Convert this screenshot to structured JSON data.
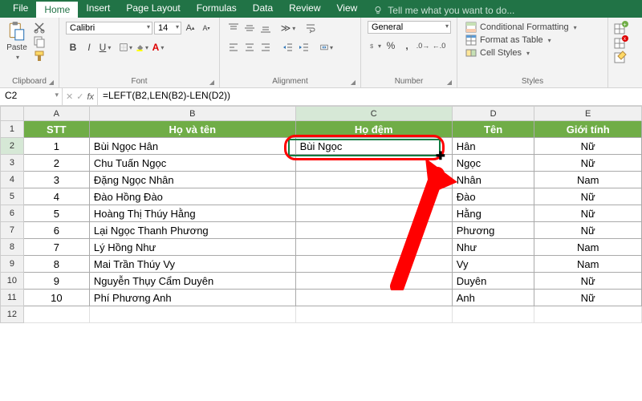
{
  "tabs": [
    "File",
    "Home",
    "Insert",
    "Page Layout",
    "Formulas",
    "Data",
    "Review",
    "View"
  ],
  "tellme": "Tell me what you want to do...",
  "clipboard": {
    "paste": "Paste",
    "label": "Clipboard"
  },
  "font": {
    "name": "Calibri",
    "size": "14",
    "label": "Font"
  },
  "alignment": {
    "label": "Alignment"
  },
  "number": {
    "format": "General",
    "label": "Number"
  },
  "styles": {
    "cf": "Conditional Formatting",
    "ft": "Format as Table",
    "cs": "Cell Styles",
    "label": "Styles"
  },
  "namebox": "C2",
  "formula": "=LEFT(B2,LEN(B2)-LEN(D2))",
  "cols": [
    "A",
    "B",
    "C",
    "D",
    "E"
  ],
  "headers": {
    "stt": "STT",
    "name": "Họ và tên",
    "mid": "Họ đệm",
    "last": "Tên",
    "sex": "Giới tính"
  },
  "chart_data": {
    "type": "table",
    "columns": [
      "STT",
      "Họ và tên",
      "Họ đệm",
      "Tên",
      "Giới tính"
    ],
    "rows": [
      {
        "stt": "1",
        "name": "Bùi Ngọc Hân",
        "mid": "Bùi Ngọc",
        "last": "Hân",
        "sex": "Nữ"
      },
      {
        "stt": "2",
        "name": "Chu Tuấn Ngọc",
        "mid": "",
        "last": "Ngọc",
        "sex": "Nữ"
      },
      {
        "stt": "3",
        "name": "Đặng Ngọc Nhân",
        "mid": "",
        "last": "Nhân",
        "sex": "Nam"
      },
      {
        "stt": "4",
        "name": "Đào Hồng Đào",
        "mid": "",
        "last": "Đào",
        "sex": "Nữ"
      },
      {
        "stt": "5",
        "name": "Hoàng Thị Thúy Hằng",
        "mid": "",
        "last": "Hằng",
        "sex": "Nữ"
      },
      {
        "stt": "6",
        "name": "Lại Ngọc Thanh Phương",
        "mid": "",
        "last": "Phương",
        "sex": "Nữ"
      },
      {
        "stt": "7",
        "name": "Lý Hồng Như",
        "mid": "",
        "last": "Như",
        "sex": "Nam"
      },
      {
        "stt": "8",
        "name": "Mai Trần Thúy Vy",
        "mid": "",
        "last": "Vy",
        "sex": "Nam"
      },
      {
        "stt": "9",
        "name": "Nguyễn Thụy Cẩm Duyên",
        "mid": "",
        "last": "Duyên",
        "sex": "Nữ"
      },
      {
        "stt": "10",
        "name": "Phí Phương Anh",
        "mid": "",
        "last": "Anh",
        "sex": "Nữ"
      }
    ]
  }
}
